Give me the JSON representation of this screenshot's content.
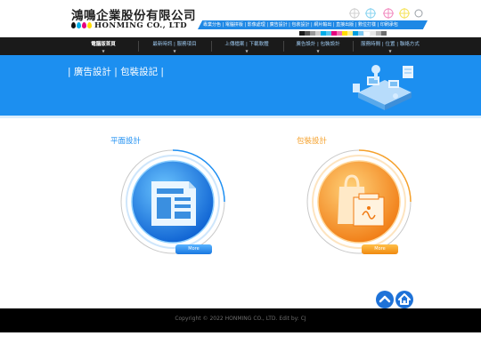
{
  "header": {
    "company_cn": "鴻鳴企業股份有限公司",
    "company_en": "HONMING CO., LTD",
    "services": "專業分色 | 電腦拼版 | 影像處理 | 廣告設計 | 包裝設計 | 網片輸出 | 直接出版 | 數位打樣 | 印刷承包"
  },
  "nav": {
    "items": [
      {
        "label": "電腦版首頁",
        "active": true
      },
      {
        "label": "最新時訊 | 服務項目"
      },
      {
        "label": "上傳檔案 | 下載軟體"
      },
      {
        "label": "廣告設計 | 包裝設計"
      },
      {
        "label": "服務時間 | 位置 | 聯絡方式"
      }
    ]
  },
  "banner": {
    "title": "| 廣告設計 | 包裝設記 |"
  },
  "cards": {
    "left": {
      "title": "平面設計",
      "more": "More",
      "color": "#1e8ff2"
    },
    "right": {
      "title": "包裝設計",
      "more": "More",
      "color": "#f5a02a"
    }
  },
  "footer": {
    "copyright": "Copyright © 2022 HONMING CO., LTD.   Edit by: CJ"
  },
  "icons": {
    "top": "chevron-up-icon",
    "home": "home-icon"
  }
}
